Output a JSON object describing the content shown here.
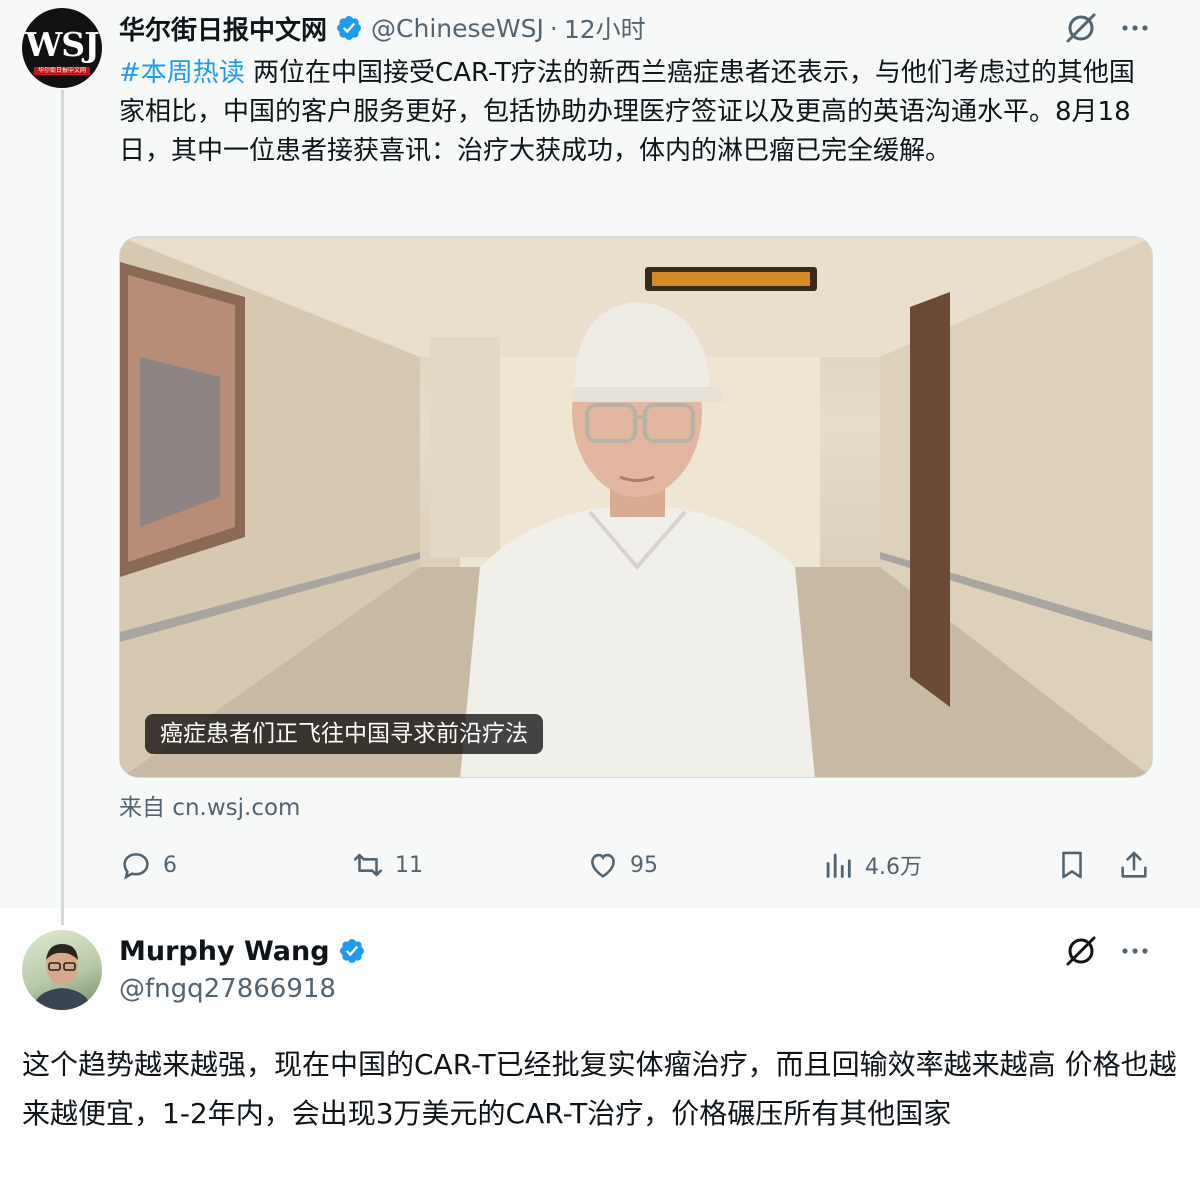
{
  "original_tweet": {
    "author_name": "华尔街日报中文网",
    "handle": "@ChineseWSJ",
    "separator": "·",
    "time": "12小时",
    "avatar_text": "WSJ",
    "avatar_subtext": "华尔街日报中文网",
    "hashtag": "#本周热读",
    "body": " 两位在中国接受CAR-T疗法的新西兰癌症患者还表示，与他们考虑过的其他国家相比，中国的客户服务更好，包括协助办理医疗签证以及更高的英语沟通水平。8月18日，其中一位患者接获喜讯：治疗大获成功，体内的淋巴瘤已完全缓解。",
    "media_caption": "癌症患者们正飞往中国寻求前沿疗法",
    "source": "来自 cn.wsj.com",
    "stats": {
      "replies": "6",
      "reposts": "11",
      "likes": "95",
      "views": "4.6万"
    }
  },
  "reply": {
    "author_name": "Murphy Wang",
    "handle": "@fngq27866918",
    "body": "这个趋势越来越强，现在中国的CAR-T已经批复实体瘤治疗，而且回输效率越来越高 价格也越来越便宜，1-2年内，会出现3万美元的CAR-T治疗，价格碾压所有其他国家"
  },
  "colors": {
    "accent": "#1d9bf0",
    "secondary_text": "#536471",
    "primary_text": "#0f1419",
    "parent_background": "#f7f9f9"
  },
  "icons": [
    "verified-badge-icon",
    "grok-icon",
    "more-icon",
    "reply-icon",
    "repost-icon",
    "like-icon",
    "views-icon",
    "bookmark-icon",
    "share-icon"
  ]
}
